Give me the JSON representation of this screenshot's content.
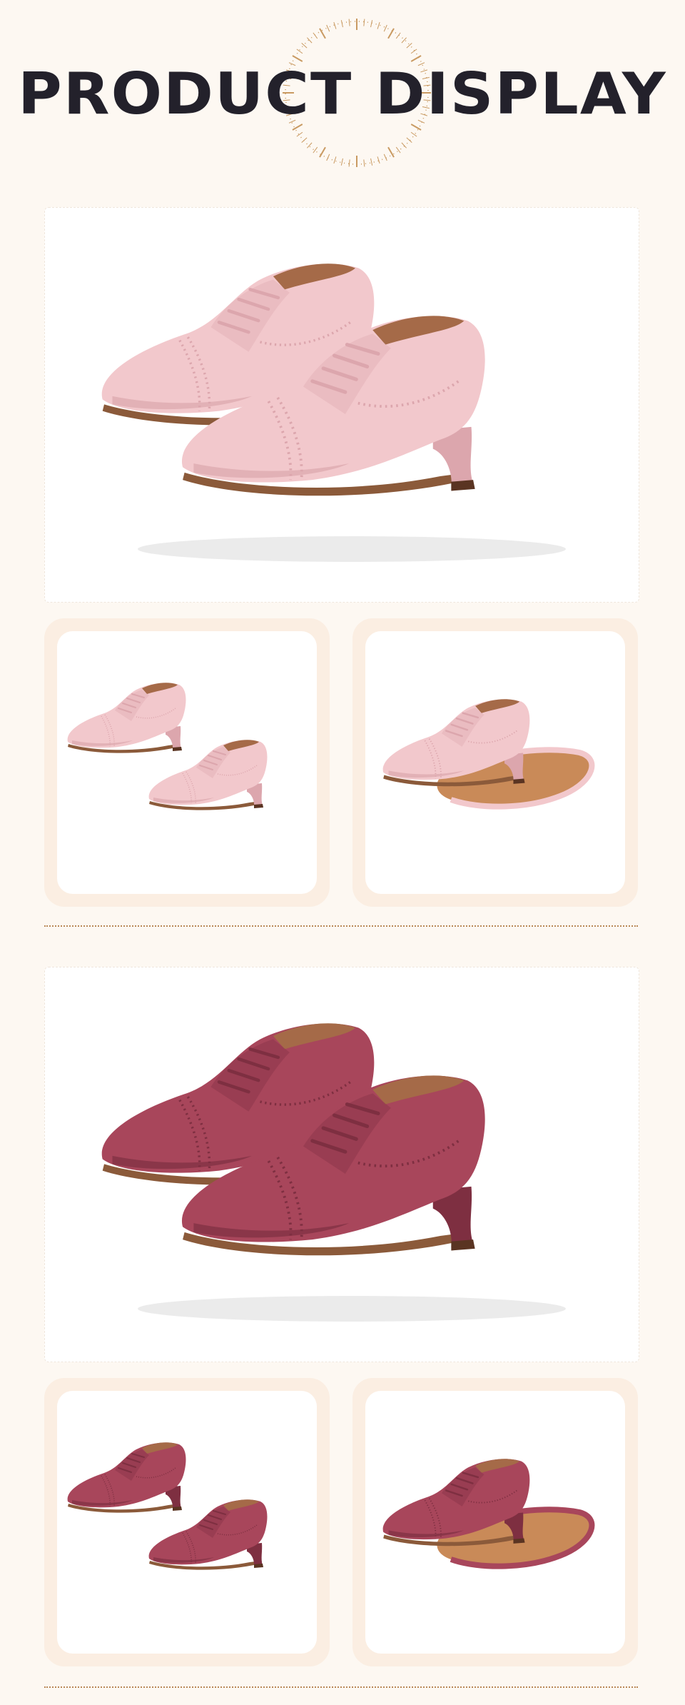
{
  "header": {
    "title": "PRODUCT DISPLAY"
  },
  "colors": {
    "background": "#fdf8f2",
    "title": "#23212b",
    "frame": "#fbeee2",
    "divider": "#b98856",
    "pink_shoe": "#f2c8cc",
    "pink_shoe_shadow": "#dca6ad",
    "mauve_shoe": "#a8465b",
    "mauve_shoe_shadow": "#7e2f41",
    "lining": "#a56a48",
    "sole": "#c98a58"
  },
  "sections": [
    {
      "variant": "pink",
      "views": [
        "main-view",
        "pair-side-view",
        "sole-view"
      ]
    },
    {
      "variant": "mauve",
      "views": [
        "main-view",
        "pair-side-view",
        "sole-view"
      ]
    }
  ]
}
